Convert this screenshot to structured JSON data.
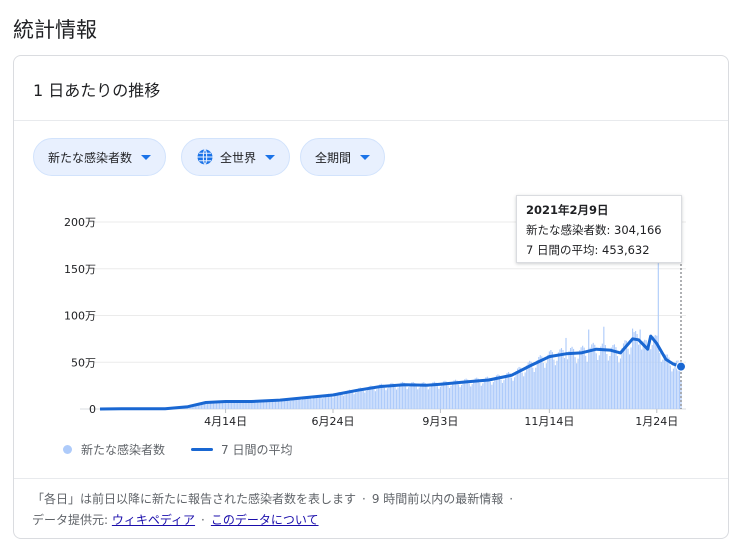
{
  "page_title": "統計情報",
  "card_title": "1 日あたりの推移",
  "filters": {
    "metric": "新たな感染者数",
    "region": "全世界",
    "period": "全期間"
  },
  "tooltip": {
    "date": "2021年2月9日",
    "cases_label": "新たな感染者数: 304,166",
    "avg_label": "7 日間の平均: 453,632"
  },
  "legend": {
    "bars": "新たな感染者数",
    "line": "7 日間の平均"
  },
  "footer": {
    "note": "「各日」は前日以降に新たに報告された感染者数を表します",
    "update": "9 時間前以内の最新情報",
    "source_prefix": "データ提供元:",
    "source_link": "ウィキペディア",
    "about_link": "このデータについて"
  },
  "colors": {
    "bars": "#aecbfa",
    "line": "#1967d2",
    "chip_bg": "#e8f0fe",
    "accent": "#1a73e8"
  },
  "chart_data": {
    "type": "bar",
    "ylim": [
      0,
      2000000
    ],
    "y_ticks": [
      {
        "value": 0,
        "label": "0"
      },
      {
        "value": 500000,
        "label": "50万"
      },
      {
        "value": 1000000,
        "label": "100万"
      },
      {
        "value": 1500000,
        "label": "150万"
      },
      {
        "value": 2000000,
        "label": "200万"
      }
    ],
    "x_start": "2020-01-22",
    "x_end": "2021-02-09",
    "x_ticks": [
      {
        "date": "2020-04-14",
        "label": "4月14日"
      },
      {
        "date": "2020-06-24",
        "label": "6月24日"
      },
      {
        "date": "2020-09-03",
        "label": "9月3日"
      },
      {
        "date": "2020-11-14",
        "label": "11月14日"
      },
      {
        "date": "2021-01-24",
        "label": "1月24日"
      }
    ],
    "series": [
      {
        "name": "7 日間の平均",
        "kind": "line",
        "points": [
          [
            "2020-01-22",
            500
          ],
          [
            "2020-02-05",
            3000
          ],
          [
            "2020-02-20",
            2000
          ],
          [
            "2020-03-05",
            3000
          ],
          [
            "2020-03-20",
            25000
          ],
          [
            "2020-04-01",
            70000
          ],
          [
            "2020-04-14",
            80000
          ],
          [
            "2020-05-01",
            80000
          ],
          [
            "2020-05-20",
            95000
          ],
          [
            "2020-06-05",
            120000
          ],
          [
            "2020-06-24",
            150000
          ],
          [
            "2020-07-10",
            200000
          ],
          [
            "2020-07-25",
            240000
          ],
          [
            "2020-08-10",
            260000
          ],
          [
            "2020-08-25",
            255000
          ],
          [
            "2020-09-03",
            265000
          ],
          [
            "2020-09-20",
            290000
          ],
          [
            "2020-10-05",
            310000
          ],
          [
            "2020-10-20",
            360000
          ],
          [
            "2020-11-01",
            460000
          ],
          [
            "2020-11-14",
            560000
          ],
          [
            "2020-11-25",
            590000
          ],
          [
            "2020-12-05",
            600000
          ],
          [
            "2020-12-15",
            640000
          ],
          [
            "2020-12-24",
            630000
          ],
          [
            "2020-12-31",
            600000
          ],
          [
            "2021-01-08",
            750000
          ],
          [
            "2021-01-12",
            740000
          ],
          [
            "2021-01-18",
            640000
          ],
          [
            "2021-01-20",
            780000
          ],
          [
            "2021-01-24",
            700000
          ],
          [
            "2021-01-30",
            530000
          ],
          [
            "2021-02-04",
            480000
          ],
          [
            "2021-02-09",
            453632
          ]
        ]
      },
      {
        "name": "新たな感染者数",
        "kind": "bar",
        "note": "daily values follow the average with weekly variation",
        "highlight": {
          "date": "2021-02-09",
          "value": 304166
        },
        "spikes": [
          {
            "date": "2020-11-25",
            "value": 760000
          },
          {
            "date": "2020-12-10",
            "value": 850000
          },
          {
            "date": "2020-12-20",
            "value": 880000
          },
          {
            "date": "2021-01-08",
            "value": 860000
          },
          {
            "date": "2021-01-13",
            "value": 850000
          },
          {
            "date": "2021-01-25",
            "value": 1560000
          }
        ]
      }
    ]
  }
}
